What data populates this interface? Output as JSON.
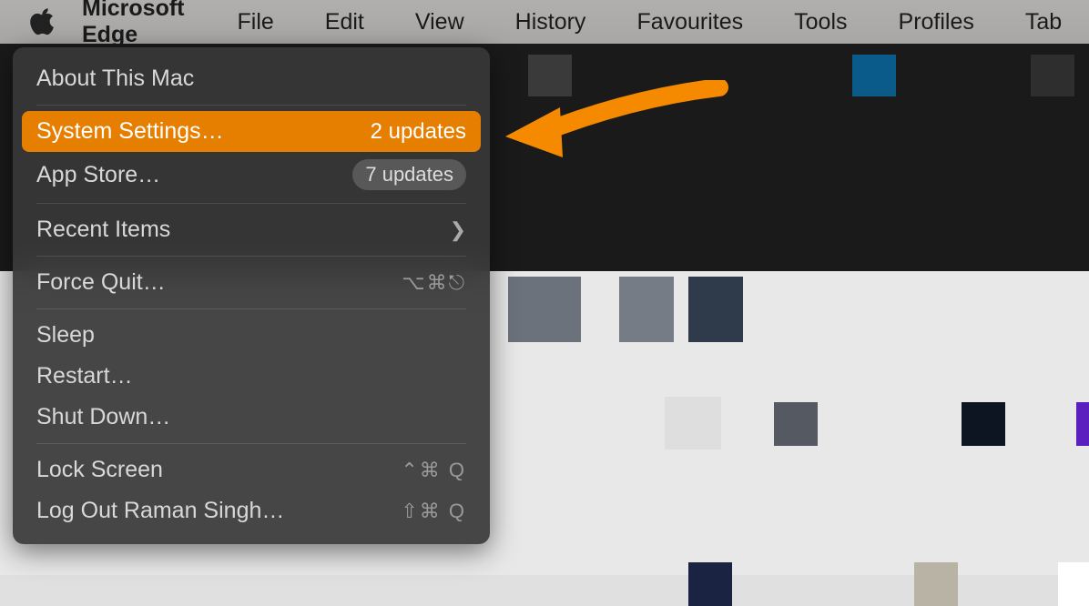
{
  "menubar": {
    "app_name": "Microsoft Edge",
    "items": [
      "File",
      "Edit",
      "View",
      "History",
      "Favourites",
      "Tools",
      "Profiles",
      "Tab"
    ]
  },
  "apple_menu": {
    "about": "About This Mac",
    "system_settings": {
      "label": "System Settings…",
      "badge": "2 updates"
    },
    "app_store": {
      "label": "App Store…",
      "badge": "7 updates"
    },
    "recent_items": "Recent Items",
    "force_quit": {
      "label": "Force Quit…",
      "shortcut": "⌥⌘⎋"
    },
    "sleep": "Sleep",
    "restart": "Restart…",
    "shutdown": "Shut Down…",
    "lock_screen": {
      "label": "Lock Screen",
      "shortcut": "⌃⌘ Q"
    },
    "log_out": {
      "label": "Log Out Raman Singh…",
      "shortcut": "⇧⌘ Q"
    }
  },
  "annotation": {
    "arrow_color": "#f58a00"
  }
}
